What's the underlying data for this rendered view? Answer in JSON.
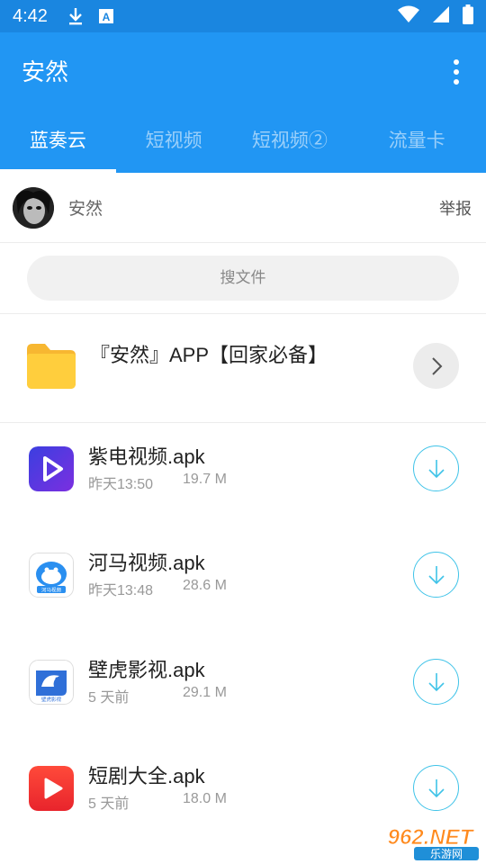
{
  "status_bar": {
    "time": "4:42",
    "left_icons": [
      "download-icon",
      "a-box-icon"
    ],
    "right_icons": [
      "wifi-icon",
      "signal-icon",
      "battery-icon"
    ]
  },
  "app_bar": {
    "title": "安然",
    "menu_icon": "more-vertical-icon",
    "color": "#2196f3"
  },
  "tabs": [
    {
      "label": "蓝奏云",
      "active": true
    },
    {
      "label": "短视频",
      "active": false
    },
    {
      "label": "短视频②",
      "active": false
    },
    {
      "label": "流量卡",
      "active": false
    }
  ],
  "user": {
    "name": "安然",
    "report_label": "举报"
  },
  "search": {
    "placeholder": "搜文件"
  },
  "folder": {
    "name": "『安然』APP【回家必备】",
    "icon": "folder-icon"
  },
  "files": [
    {
      "name": "紫电视频.apk",
      "date": "昨天13:50",
      "size": "19.7 M",
      "icon": "zidian-app-icon"
    },
    {
      "name": "河马视频.apk",
      "date": "昨天13:48",
      "size": "28.6 M",
      "icon": "hema-app-icon",
      "icon_text": "河马视频"
    },
    {
      "name": "壁虎影视.apk",
      "date": "5 天前",
      "size": "29.1 M",
      "icon": "bihu-app-icon",
      "icon_text": "壁虎影视"
    },
    {
      "name": "短剧大全.apk",
      "date": "5 天前",
      "size": "18.0 M",
      "icon": "duanju-app-icon"
    }
  ],
  "watermark": {
    "brand": "962.NET",
    "sub": "乐游网"
  },
  "colors": {
    "accent": "#2196f3",
    "download_ring": "#3fc3e8",
    "folder_yellow": "#ffc93a"
  }
}
